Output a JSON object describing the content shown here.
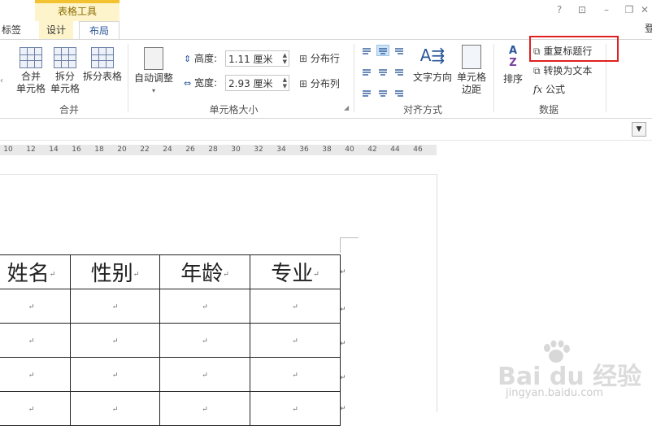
{
  "context_group": "表格工具",
  "tabs": {
    "partial": "标签",
    "design": "设计",
    "layout": "布局"
  },
  "window_buttons": [
    "?",
    "⊡",
    "–",
    "❐",
    "✕"
  ],
  "edge_text": "登",
  "groups": {
    "merge": {
      "label": "合并",
      "merge_cells": "合并\n单元格",
      "split_cells": "拆分\n单元格",
      "split_table": "拆分表格"
    },
    "cell_size": {
      "label": "单元格大小",
      "autofit": "自动调整",
      "height_label": "高度:",
      "height_value": "1.11 厘米",
      "width_label": "宽度:",
      "width_value": "2.93 厘米",
      "distribute_rows": "分布行",
      "distribute_cols": "分布列"
    },
    "alignment": {
      "label": "对齐方式",
      "text_direction": "文字方向",
      "cell_margins": "单元格\n边距"
    },
    "data": {
      "label": "数据",
      "sort": "排序",
      "repeat_header": "重复标题行",
      "convert_text": "转换为文本",
      "formula": "公式"
    }
  },
  "ruler_ticks": [
    "10",
    "12",
    "14",
    "16",
    "18",
    "20",
    "22",
    "24",
    "26",
    "28",
    "30",
    "32",
    "34",
    "36",
    "38",
    "40",
    "42",
    "44",
    "46"
  ],
  "table": {
    "header": [
      "姓名",
      "性别",
      "年龄",
      "专业"
    ],
    "rows": 4
  },
  "mark": "↵",
  "watermark": {
    "main": "Bai du 经验",
    "sub": "jingyan.baidu.com"
  },
  "colors": {
    "context_tab": "#fef4cc",
    "context_border": "#f3c230",
    "highlight": "#e02020",
    "selected_align": "#cde3f7"
  }
}
